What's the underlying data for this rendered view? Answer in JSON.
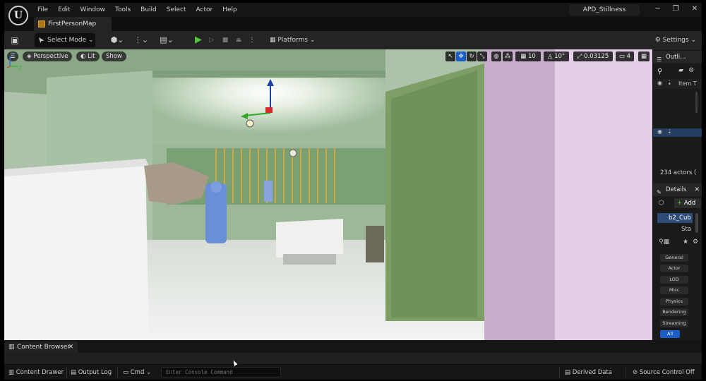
{
  "menu": [
    "File",
    "Edit",
    "Window",
    "Tools",
    "Build",
    "Select",
    "Actor",
    "Help"
  ],
  "project_name": "APD_Stillness",
  "map_tab": "FirstPersonMap",
  "toolbar": {
    "select_mode": "Select Mode",
    "platforms": "Platforms",
    "settings": "Settings"
  },
  "viewport": {
    "perspective": "Perspective",
    "lit": "Lit",
    "show": "Show",
    "grid_snap": "10",
    "rot_snap": "10°",
    "scale_snap": "0.03125",
    "camera_speed": "4"
  },
  "outliner": {
    "title": "Outli…",
    "col": "Item T",
    "actor_count": "234 actors ("
  },
  "details": {
    "title": "Details",
    "add": "Add",
    "component1": "b2_Cub",
    "component2": "Sta"
  },
  "categories": [
    "General",
    "Actor",
    "LOD",
    "Misc",
    "Physics",
    "Rendering",
    "Streaming",
    "All"
  ],
  "content_browser": {
    "tab": "Content Browser"
  },
  "statusbar": {
    "content_drawer": "Content Drawer",
    "output_log": "Output Log",
    "cmd": "Cmd",
    "console_placeholder": "Enter Console Command",
    "derived_data": "Derived Data",
    "source_control": "Source Control Off"
  },
  "icons": [
    "ue-logo-icon",
    "save-icon",
    "play-icon",
    "eye-icon",
    "pin-icon",
    "search-icon",
    "gear-icon",
    "star-icon"
  ]
}
